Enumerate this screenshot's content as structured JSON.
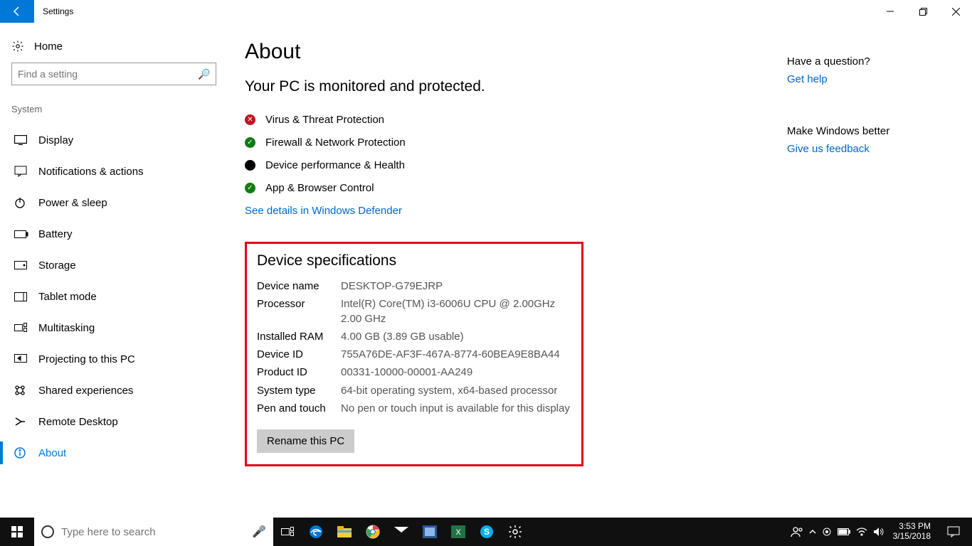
{
  "titlebar": {
    "app_name": "Settings"
  },
  "sidebar": {
    "home_label": "Home",
    "search_placeholder": "Find a setting",
    "section_label": "System",
    "items": [
      {
        "icon": "display-icon",
        "label": "Display"
      },
      {
        "icon": "notify-icon",
        "label": "Notifications & actions"
      },
      {
        "icon": "power-icon",
        "label": "Power & sleep"
      },
      {
        "icon": "battery-icon",
        "label": "Battery"
      },
      {
        "icon": "storage-icon",
        "label": "Storage"
      },
      {
        "icon": "tablet-icon",
        "label": "Tablet mode"
      },
      {
        "icon": "multitask-icon",
        "label": "Multitasking"
      },
      {
        "icon": "project-icon",
        "label": "Projecting to this PC"
      },
      {
        "icon": "shared-icon",
        "label": "Shared experiences"
      },
      {
        "icon": "remote-icon",
        "label": "Remote Desktop"
      },
      {
        "icon": "about-icon",
        "label": "About"
      }
    ]
  },
  "main": {
    "title": "About",
    "protection_heading": "Your PC is monitored and protected.",
    "statuses": [
      {
        "state": "bad",
        "label": "Virus & Threat Protection"
      },
      {
        "state": "ok",
        "label": "Firewall & Network Protection"
      },
      {
        "state": "dark",
        "label": "Device performance & Health"
      },
      {
        "state": "ok",
        "label": "App & Browser Control"
      }
    ],
    "defender_link": "See details in Windows Defender",
    "spec_title": "Device specifications",
    "specs": [
      {
        "label": "Device name",
        "value": "DESKTOP-G79EJRP"
      },
      {
        "label": "Processor",
        "value": "Intel(R) Core(TM) i3-6006U CPU @ 2.00GHz   2.00 GHz"
      },
      {
        "label": "Installed RAM",
        "value": "4.00 GB (3.89 GB usable)"
      },
      {
        "label": "Device ID",
        "value": "755A76DE-AF3F-467A-8774-60BEA9E8BA44"
      },
      {
        "label": "Product ID",
        "value": "00331-10000-00001-AA249"
      },
      {
        "label": "System type",
        "value": "64-bit operating system, x64-based processor"
      },
      {
        "label": "Pen and touch",
        "value": "No pen or touch input is available for this display"
      }
    ],
    "rename_label": "Rename this PC"
  },
  "help": {
    "question": "Have a question?",
    "get_help": "Get help",
    "better": "Make Windows better",
    "feedback": "Give us feedback"
  },
  "taskbar": {
    "search_placeholder": "Type here to search",
    "time": "3:53 PM",
    "date": "3/15/2018"
  }
}
